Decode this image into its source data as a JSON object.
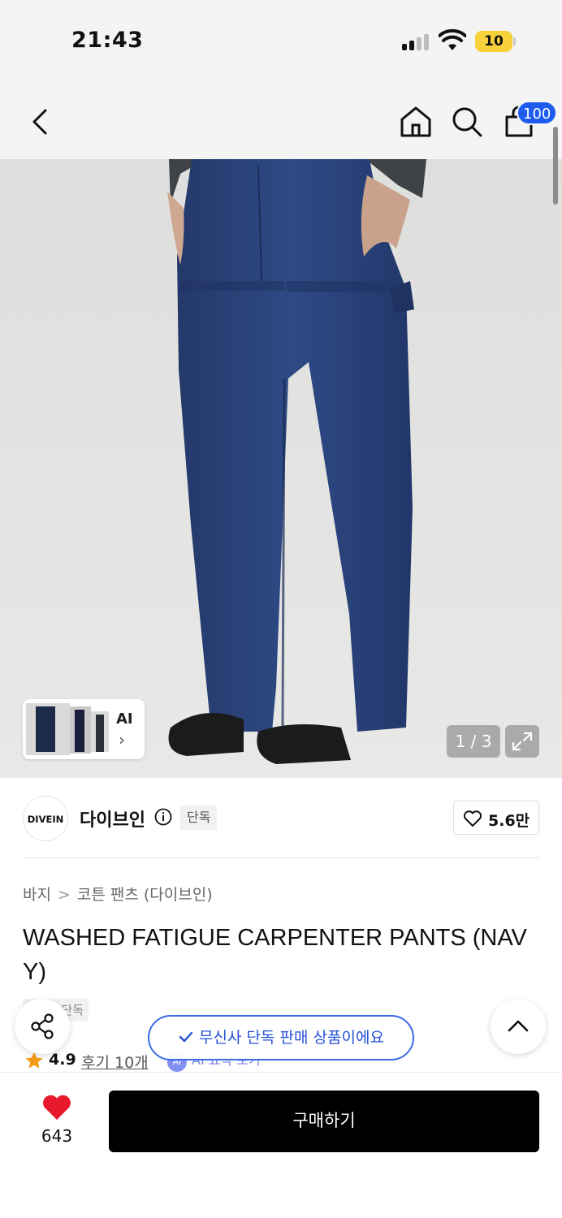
{
  "status_bar": {
    "time": "21:43",
    "battery": "10"
  },
  "nav": {
    "cart_count": "100"
  },
  "gallery": {
    "page_counter": "1 / 3",
    "thumb_label": "AI",
    "thumb_chevron": "›"
  },
  "brand": {
    "logo_text": "DIVEIN",
    "name": "다이브인",
    "exclusive_badge": "단독",
    "like_count": "5.6만"
  },
  "breadcrumb": {
    "category": "바지",
    "separator": ">",
    "subcategory": "코튼 팬츠 (다이브인)"
  },
  "product": {
    "title": "WASHED FATIGUE CARPENTER PANTS (NAVY)",
    "exclusive_tag": "무신사단독",
    "rating": "4.9",
    "review_link": "후기 10개",
    "ai_badge": "AI",
    "ai_summary": "AI 요약 보기"
  },
  "toast": {
    "message": "무신사 단독 판매 상품이에요"
  },
  "bottom_bar": {
    "like_count": "643",
    "buy_label": "구매하기"
  },
  "colors": {
    "accent_blue": "#1e5cf0",
    "like_red": "#e8192c",
    "buy_black": "#000000",
    "star_orange": "#f29a13"
  }
}
